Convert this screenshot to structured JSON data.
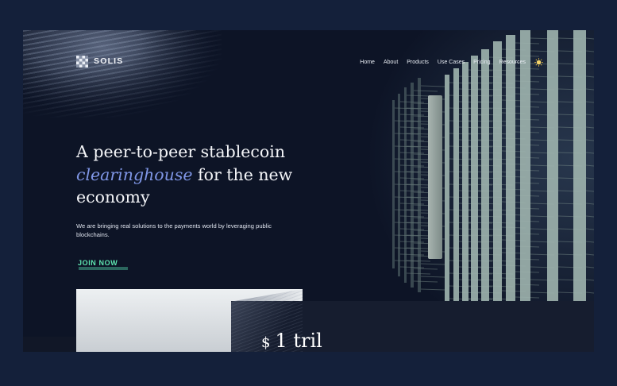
{
  "brand": {
    "name": "SOLIS",
    "logo_icon": "checker-diamond-logo-icon"
  },
  "nav": {
    "items": [
      "Home",
      "About",
      "Products",
      "Use Cases",
      "Pricing",
      "Resources"
    ],
    "theme_toggle_icon": "sun-icon"
  },
  "hero": {
    "headline_start": "A peer-to-peer stablecoin",
    "headline_accent": "clearinghouse",
    "headline_end": "for the new economy",
    "subtitle": "We are bringing real solutions to the payments world by leveraging public blockchains.",
    "cta_label": "JOIN NOW"
  },
  "stat": {
    "prefix": "$",
    "value": "1 tril"
  },
  "colors": {
    "page_bg": "#14203a",
    "hero_bg": "#0d1426",
    "accent_blue": "#7f96e6",
    "cta_green": "#5ee6b1"
  }
}
